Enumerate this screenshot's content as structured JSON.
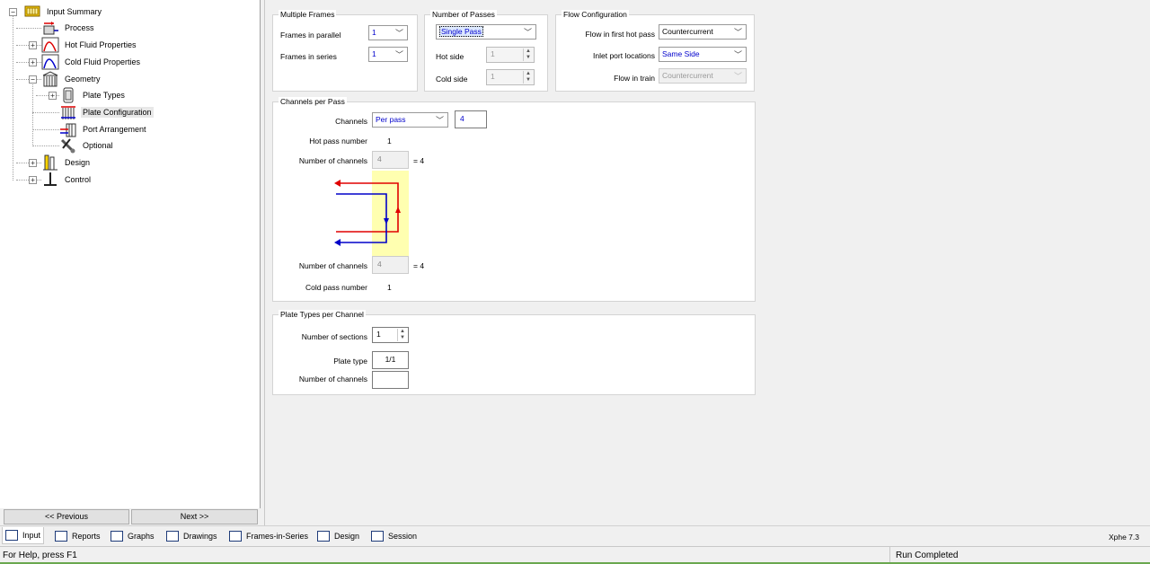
{
  "tree": {
    "items": [
      {
        "label": "Input Summary",
        "icon": "input-summary-icon"
      },
      {
        "label": "Process",
        "icon": "process-icon"
      },
      {
        "label": "Hot Fluid Properties",
        "icon": "hot-fluid-icon"
      },
      {
        "label": "Cold Fluid Properties",
        "icon": "cold-fluid-icon"
      },
      {
        "label": "Geometry",
        "icon": "geometry-icon"
      },
      {
        "label": "Plate Types",
        "icon": "plate-types-icon"
      },
      {
        "label": "Plate Configuration",
        "icon": "plate-configuration-icon"
      },
      {
        "label": "Port Arrangement",
        "icon": "port-arrangement-icon"
      },
      {
        "label": "Optional",
        "icon": "optional-icon"
      },
      {
        "label": "Design",
        "icon": "design-icon"
      },
      {
        "label": "Control",
        "icon": "control-icon"
      }
    ],
    "selected": "Plate Configuration",
    "expander_minus": "−",
    "expander_plus": "+"
  },
  "nav": {
    "previous": "<< Previous",
    "next": "Next >>"
  },
  "multiple_frames": {
    "title": "Multiple Frames",
    "frames_parallel_label": "Frames in parallel",
    "frames_parallel_value": "1",
    "frames_series_label": "Frames in series",
    "frames_series_value": "1"
  },
  "number_of_passes": {
    "title": "Number of Passes",
    "pass_value": "Single Pass",
    "hot_side_label": "Hot side",
    "hot_side_value": "1",
    "cold_side_label": "Cold side",
    "cold_side_value": "1"
  },
  "flow_configuration": {
    "title": "Flow Configuration",
    "flow_first_label": "Flow in first hot pass",
    "flow_first_value": "Countercurrent",
    "inlet_label": "Inlet port locations",
    "inlet_value": "Same Side",
    "flow_train_label": "Flow in train",
    "flow_train_value": "Countercurrent"
  },
  "channels_per_pass": {
    "title": "Channels per Pass",
    "channels_label": "Channels",
    "channels_mode": "Per pass",
    "channels_value": "4",
    "hot_pass_label": "Hot pass number",
    "hot_pass_value": "1",
    "hot_channels_label": "Number of channels",
    "hot_channels_value": "4",
    "hot_channels_total": "= 4",
    "cold_channels_label": "Number of channels",
    "cold_channels_value": "4",
    "cold_channels_total": "= 4",
    "cold_pass_label": "Cold pass number",
    "cold_pass_value": "1",
    "hot_color": "#e00000",
    "cold_color": "#0000c8",
    "plate_color": "#ffffb0"
  },
  "plate_types_per_channel": {
    "title": "Plate Types per Channel",
    "sections_label": "Number of sections",
    "sections_value": "1",
    "plate_type_label": "Plate type",
    "plate_type_value": "1/1",
    "num_channels_label": "Number of channels",
    "num_channels_value": ""
  },
  "tabs": [
    {
      "label": "Input",
      "icon": "input-tab-icon"
    },
    {
      "label": "Reports",
      "icon": "reports-tab-icon"
    },
    {
      "label": "Graphs",
      "icon": "graphs-tab-icon"
    },
    {
      "label": "Drawings",
      "icon": "drawings-tab-icon"
    },
    {
      "label": "Frames-in-Series",
      "icon": "frames-in-series-tab-icon"
    },
    {
      "label": "Design",
      "icon": "design-tab-icon"
    },
    {
      "label": "Session",
      "icon": "session-tab-icon"
    }
  ],
  "version": "Xphe 7.3",
  "status": {
    "help": "For Help, press F1",
    "run": "Run Completed"
  }
}
